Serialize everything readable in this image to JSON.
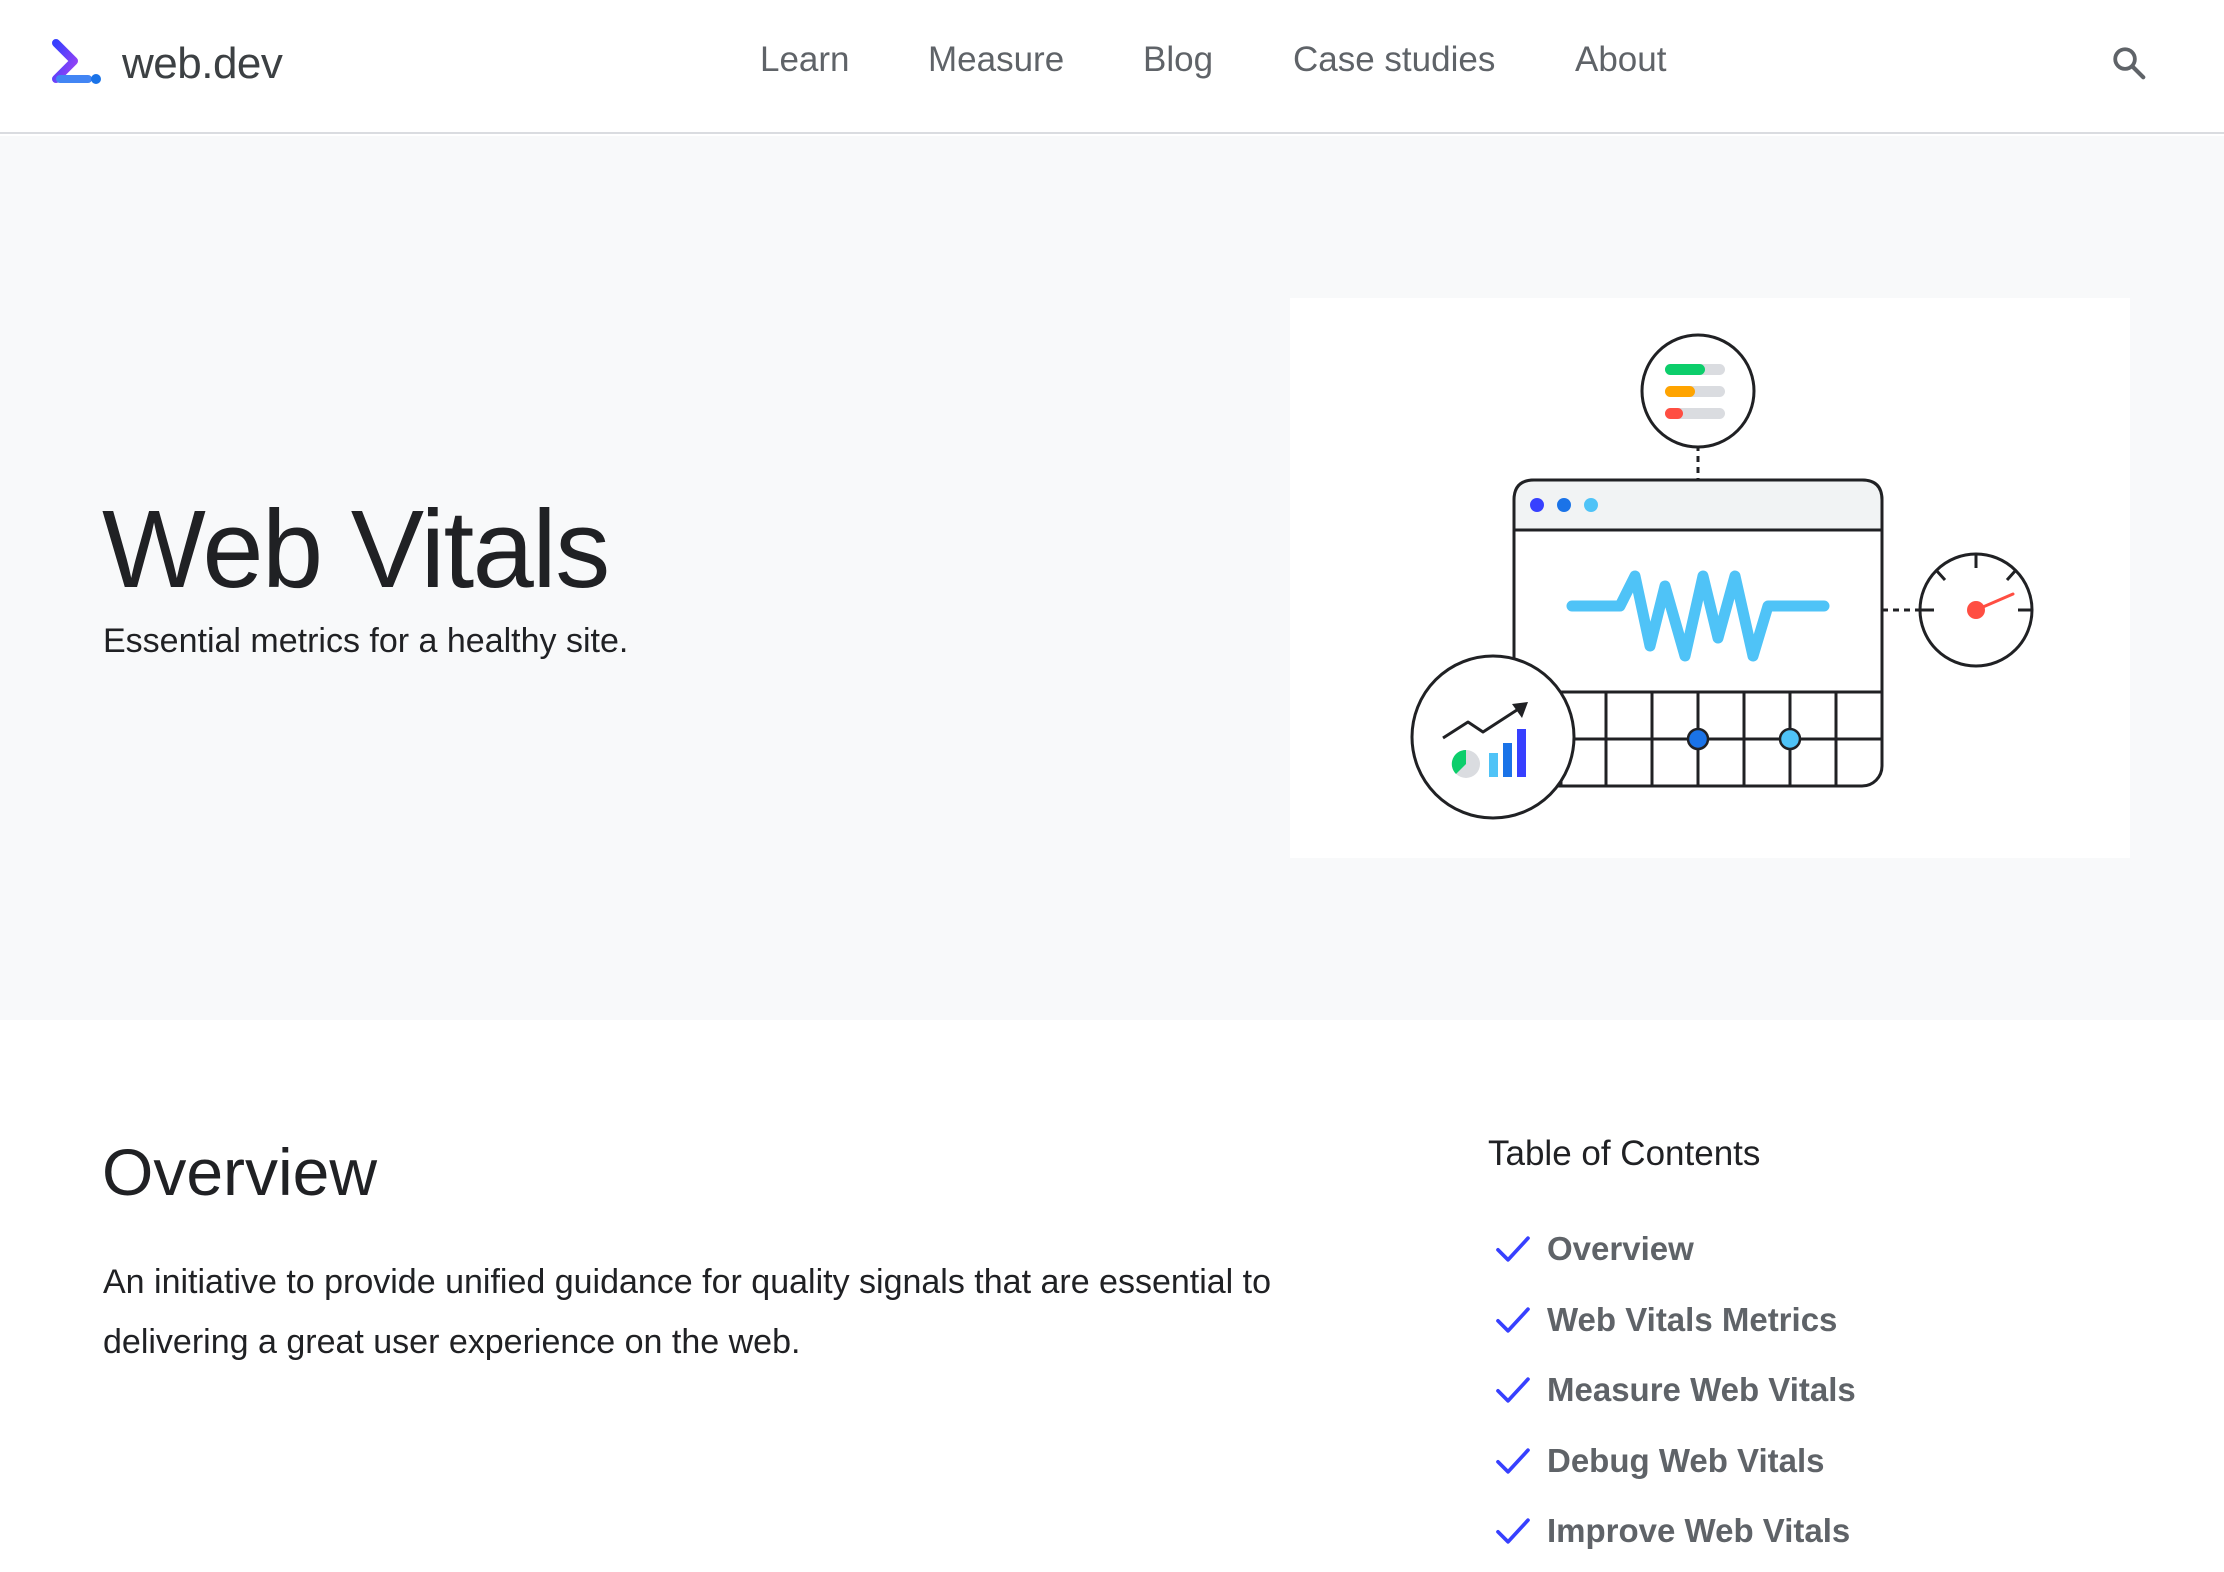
{
  "header": {
    "brand": "web.dev",
    "nav": [
      {
        "label": "Learn"
      },
      {
        "label": "Measure"
      },
      {
        "label": "Blog"
      },
      {
        "label": "Case studies"
      },
      {
        "label": "About"
      }
    ],
    "search_icon": "search-icon"
  },
  "hero": {
    "title": "Web Vitals",
    "subtitle": "Essential metrics for a healthy site."
  },
  "main": {
    "overview_heading": "Overview",
    "overview_body": "An initiative to provide unified guidance for quality signals that are essential to delivering a great user experience on the web."
  },
  "toc": {
    "title": "Table of Contents",
    "items": [
      {
        "label": "Overview"
      },
      {
        "label": "Web Vitals Metrics"
      },
      {
        "label": "Measure Web Vitals"
      },
      {
        "label": "Debug Web Vitals"
      },
      {
        "label": "Improve Web Vitals"
      }
    ],
    "check_icon": "check-icon"
  },
  "colors": {
    "accent": "#3740ff",
    "hero_bg": "#f8f9fa",
    "nav_text": "#5f6368",
    "wave": "#4fc3f7",
    "good": "#0cce6b",
    "needs_improvement": "#ffa400",
    "poor": "#ff4e42"
  }
}
